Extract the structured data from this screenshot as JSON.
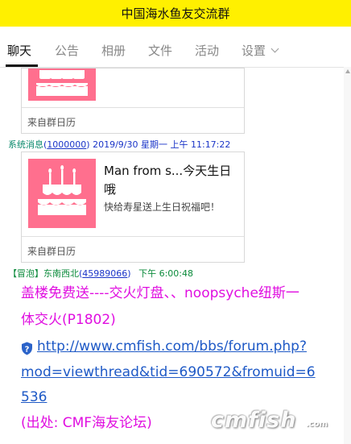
{
  "window": {
    "title": "中国海水鱼友交流群"
  },
  "tabs": [
    {
      "label": "聊天",
      "active": true
    },
    {
      "label": "公告"
    },
    {
      "label": "相册"
    },
    {
      "label": "文件"
    },
    {
      "label": "活动"
    },
    {
      "label": "设置"
    }
  ],
  "messages": {
    "card1": {
      "source": "来自群日历"
    },
    "system": {
      "sender": "系统消息",
      "uid_open": "(",
      "uid": "1000000",
      "uid_close": ")",
      "datetime": "2019/9/30 星期一 上午 11:17:22"
    },
    "card2": {
      "title": "Man from s...今天生日哦",
      "subtitle": "快给寿星送上生日祝福吧！",
      "source": "来自群日历"
    },
    "member": {
      "badge": "【冒泡】",
      "sender": "东南西北",
      "uid_open": "(",
      "uid": "45989066",
      "uid_close": ")",
      "time": "下午 6:00:48"
    },
    "post": {
      "line1": "盖楼免费送----交火灯盘、、noopsyche纽斯一",
      "line2": "体交火(P1802)",
      "link1": "http://www.cmfish.com/bbs/forum.php?",
      "link2": "mod=viewthread&tid=690572&fromuid=6",
      "link3": "536",
      "source": "(出处: CMF海友论坛)"
    }
  },
  "watermark": {
    "logo": "cmfish",
    "suffix": ".com"
  },
  "colors": {
    "titlebar": "#fff000",
    "cake": "#ff6f8e",
    "post_text": "#e00ee0",
    "link": "#1e59c6"
  },
  "icons": [
    "chevron-down-icon",
    "scroll-up-arrow-icon",
    "birthday-cake-icon",
    "shield-question-icon"
  ]
}
